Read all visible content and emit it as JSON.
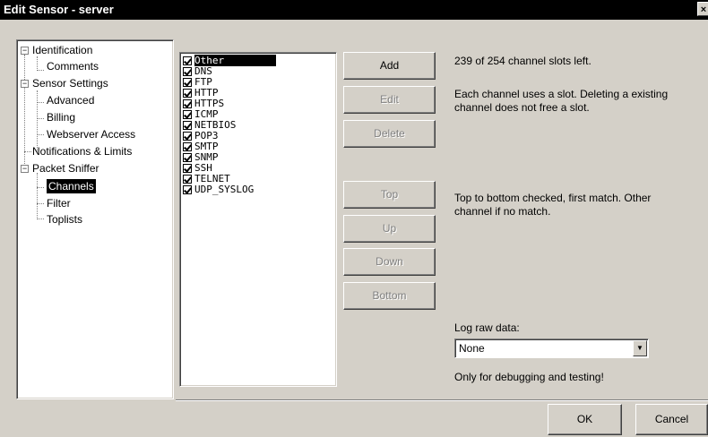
{
  "window": {
    "title": "Edit Sensor - server",
    "close_glyph": "×"
  },
  "tree": {
    "items": [
      {
        "label": "Identification",
        "expand": "−"
      },
      {
        "label": "Comments"
      },
      {
        "label": "Sensor Settings",
        "expand": "−"
      },
      {
        "label": "Advanced"
      },
      {
        "label": "Billing"
      },
      {
        "label": "Webserver Access"
      },
      {
        "label": "Notifications & Limits"
      },
      {
        "label": "Packet Sniffer",
        "expand": "−"
      },
      {
        "label": "Channels",
        "selected": true
      },
      {
        "label": "Filter"
      },
      {
        "label": "Toplists"
      }
    ]
  },
  "channels": [
    {
      "label": "Other",
      "checked": true,
      "selected": true
    },
    {
      "label": "DNS",
      "checked": true
    },
    {
      "label": "FTP",
      "checked": true
    },
    {
      "label": "HTTP",
      "checked": true
    },
    {
      "label": "HTTPS",
      "checked": true
    },
    {
      "label": "ICMP",
      "checked": true
    },
    {
      "label": "NETBIOS",
      "checked": true
    },
    {
      "label": "POP3",
      "checked": true
    },
    {
      "label": "SMTP",
      "checked": true
    },
    {
      "label": "SNMP",
      "checked": true
    },
    {
      "label": "SSH",
      "checked": true
    },
    {
      "label": "TELNET",
      "checked": true
    },
    {
      "label": "UDP_SYSLOG",
      "checked": true
    }
  ],
  "buttons": {
    "add": "Add",
    "edit": "Edit",
    "delete": "Delete",
    "top": "Top",
    "up": "Up",
    "down": "Down",
    "bottom": "Bottom"
  },
  "info": {
    "slots_left": "239 of 254 channel slots left.",
    "slot_note_1": "Each channel uses a slot. Deleting a existing",
    "slot_note_2": "channel does not free a slot.",
    "order_note_1": "Top to bottom checked, first match. Other",
    "order_note_2": "channel if no match."
  },
  "log": {
    "label": "Log raw data:",
    "value": "None",
    "arrow_icon": "▼",
    "note": "Only for debugging and testing!"
  },
  "footer": {
    "ok": "OK",
    "cancel": "Cancel"
  }
}
